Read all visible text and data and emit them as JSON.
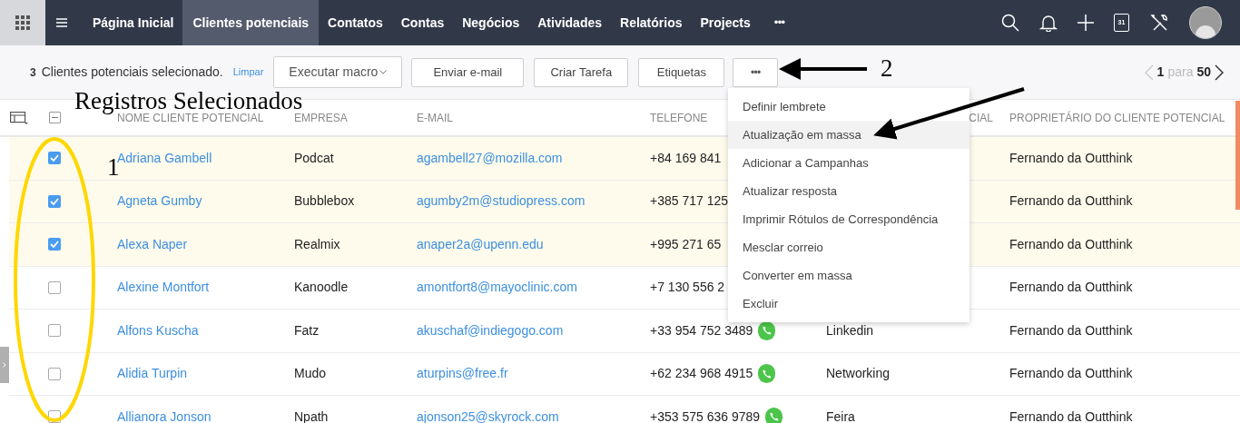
{
  "nav": {
    "items": [
      {
        "label": "Página Inicial",
        "selected": false
      },
      {
        "label": "Clientes potenciais",
        "selected": true
      },
      {
        "label": "Contatos",
        "selected": false
      },
      {
        "label": "Contas",
        "selected": false
      },
      {
        "label": "Negócios",
        "selected": false
      },
      {
        "label": "Atividades",
        "selected": false
      },
      {
        "label": "Relatórios",
        "selected": false
      },
      {
        "label": "Projects",
        "selected": false
      }
    ],
    "more": "•••",
    "calendar_day": "31"
  },
  "toolbar": {
    "count": "3",
    "selection_text": "Clientes potenciais selecionado.",
    "clear_link": "Limpar",
    "macro_dropdown": "Executar macro",
    "buttons": [
      "Enviar e-mail",
      "Criar Tarefa",
      "Etiquetas"
    ],
    "more_button": "•••",
    "pagination": {
      "from": "1",
      "separator": "para",
      "to": "50"
    }
  },
  "table": {
    "select_all_partial": true,
    "columns": [
      "NOME CLIENTE POTENCIAL",
      "EMPRESA",
      "E-MAIL",
      "TELEFONE",
      "CIAL",
      "PROPRIETÁRIO DO CLIENTE POTENCIAL"
    ],
    "rows": [
      {
        "selected": true,
        "name": "Adriana Gambell",
        "company": "Podcat",
        "email": "agambell27@mozilla.com",
        "phone": "+84 169 841",
        "phone_icon": false,
        "owner": "Fernando da Outthink"
      },
      {
        "selected": true,
        "name": "Agneta Gumby",
        "company": "Bubblebox",
        "email": "agumby2m@studiopress.com",
        "phone": "+385 717 125",
        "phone_icon": false,
        "owner": "Fernando da Outthink"
      },
      {
        "selected": true,
        "name": "Alexa Naper",
        "company": "Realmix",
        "email": "anaper2a@upenn.edu",
        "phone": "+995 271 65",
        "phone_icon": false,
        "owner": "Fernando da Outthink"
      },
      {
        "selected": false,
        "name": "Alexine Montfort",
        "company": "Kanoodle",
        "email": "amontfort8@mayoclinic.com",
        "phone": "+7 130 556 2",
        "phone_icon": false,
        "owner": "Fernando da Outthink"
      },
      {
        "selected": false,
        "name": "Alfons Kuscha",
        "company": "Fatz",
        "email": "akuschaf@indiegogo.com",
        "phone": "+33 954 752 3489",
        "phone_icon": true,
        "column_5": "Linkedin",
        "owner": "Fernando da Outthink"
      },
      {
        "selected": false,
        "name": "Alidia Turpin",
        "company": "Mudo",
        "email": "aturpins@free.fr",
        "phone": "+62 234 968 4915",
        "phone_icon": true,
        "column_5": "Networking",
        "owner": "Fernando da Outthink"
      },
      {
        "selected": false,
        "name": "Allianora Jonson",
        "company": "Npath",
        "email": "ajonson25@skyrock.com",
        "phone": "+353 575 636 9789",
        "phone_icon": true,
        "column_5": "Feira",
        "owner": "Fernando da Outthink"
      }
    ]
  },
  "menu": {
    "items": [
      {
        "label": "Definir lembrete",
        "selected": false
      },
      {
        "label": "Atualização em massa",
        "selected": true
      },
      {
        "label": "Adicionar a Campanhas",
        "selected": false
      },
      {
        "label": "Atualizar resposta",
        "selected": false
      },
      {
        "label": "Imprimir Rótulos de Correspondência",
        "selected": false
      },
      {
        "label": "Mesclar correio",
        "selected": false
      },
      {
        "label": "Converter em massa",
        "selected": false
      },
      {
        "label": "Excluir",
        "selected": false
      }
    ]
  },
  "annotations": {
    "caption": "Registros  Selecionados",
    "marker_1": "1",
    "marker_2": "2"
  }
}
